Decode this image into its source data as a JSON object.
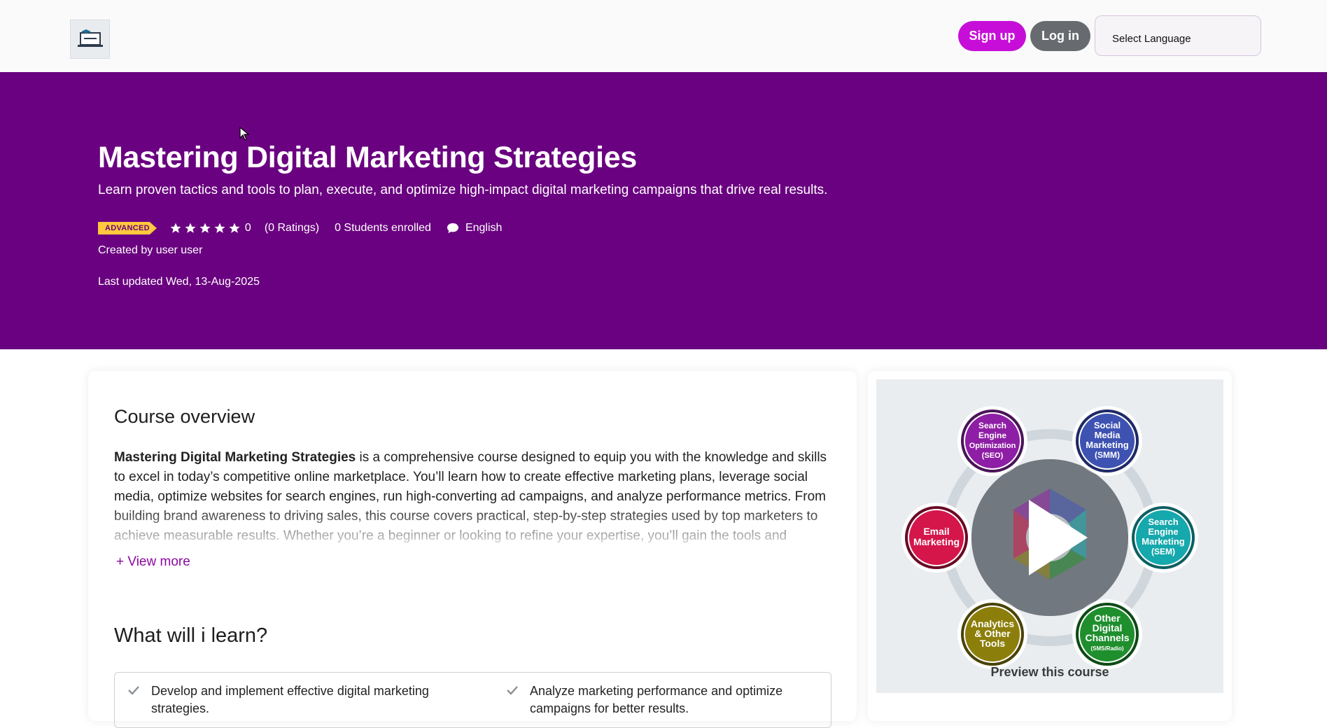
{
  "header": {
    "signup_label": "Sign up",
    "login_label": "Log in",
    "language_placeholder": "Select Language"
  },
  "hero": {
    "title": "Mastering Digital Marketing Strategies",
    "subtitle": "Learn proven tactics and tools to plan, execute, and optimize high-impact digital marketing campaigns that drive real results.",
    "level_badge": "ADVANCED",
    "rating_value": "0",
    "ratings_count": "(0 Ratings)",
    "students_enrolled": "0 Students enrolled",
    "language": "English",
    "created_by": "Created by user user",
    "last_updated": "Last updated Wed, 13-Aug-2025"
  },
  "overview": {
    "title": "Course overview",
    "bold_lead": "Mastering Digital Marketing Strategies",
    "body": " is a comprehensive course designed to equip you with the knowledge and skills to excel in today’s competitive online marketplace. You’ll learn how to create effective marketing plans, leverage social media, optimize websites for search engines, run high-converting ad campaigns, and analyze performance metrics. From building brand awareness to driving sales, this course covers practical, step-by-step strategies used by top marketers to achieve measurable results. Whether you’re a beginner or looking to refine your expertise, you’ll gain the tools and confidence to grow any business online.",
    "view_more": "+ View more"
  },
  "learn": {
    "title": "What will i learn?",
    "items": [
      "Develop and implement effective digital marketing strategies.",
      "Analyze marketing performance and optimize campaigns for better results."
    ]
  },
  "preview": {
    "label": "Preview this course",
    "bubbles": {
      "seo": [
        "Search",
        "Engine",
        "Optimization",
        "(SEO)"
      ],
      "smm": [
        "Social",
        "Media",
        "Marketing",
        "(SMM)"
      ],
      "sem": [
        "Search",
        "Engine",
        "Marketing",
        "(SEM)"
      ],
      "email": [
        "Email",
        "Marketing"
      ],
      "analytics": [
        "Analytics",
        "& Other",
        "Tools"
      ],
      "other": [
        "Other",
        "Digital",
        "Channels",
        "(SMS/Radio)"
      ]
    },
    "colors": {
      "seo": "#8e1ea5",
      "smm": "#3e52b2",
      "sem": "#15a8ac",
      "email": "#d4164b",
      "analytics": "#8c7e0a",
      "other": "#1f8f2d"
    }
  },
  "colors": {
    "brand_purple": "#6a0180",
    "signup_bg": "#c60ed8",
    "login_bg": "#676b70",
    "badge_bg": "#ffc83d"
  }
}
